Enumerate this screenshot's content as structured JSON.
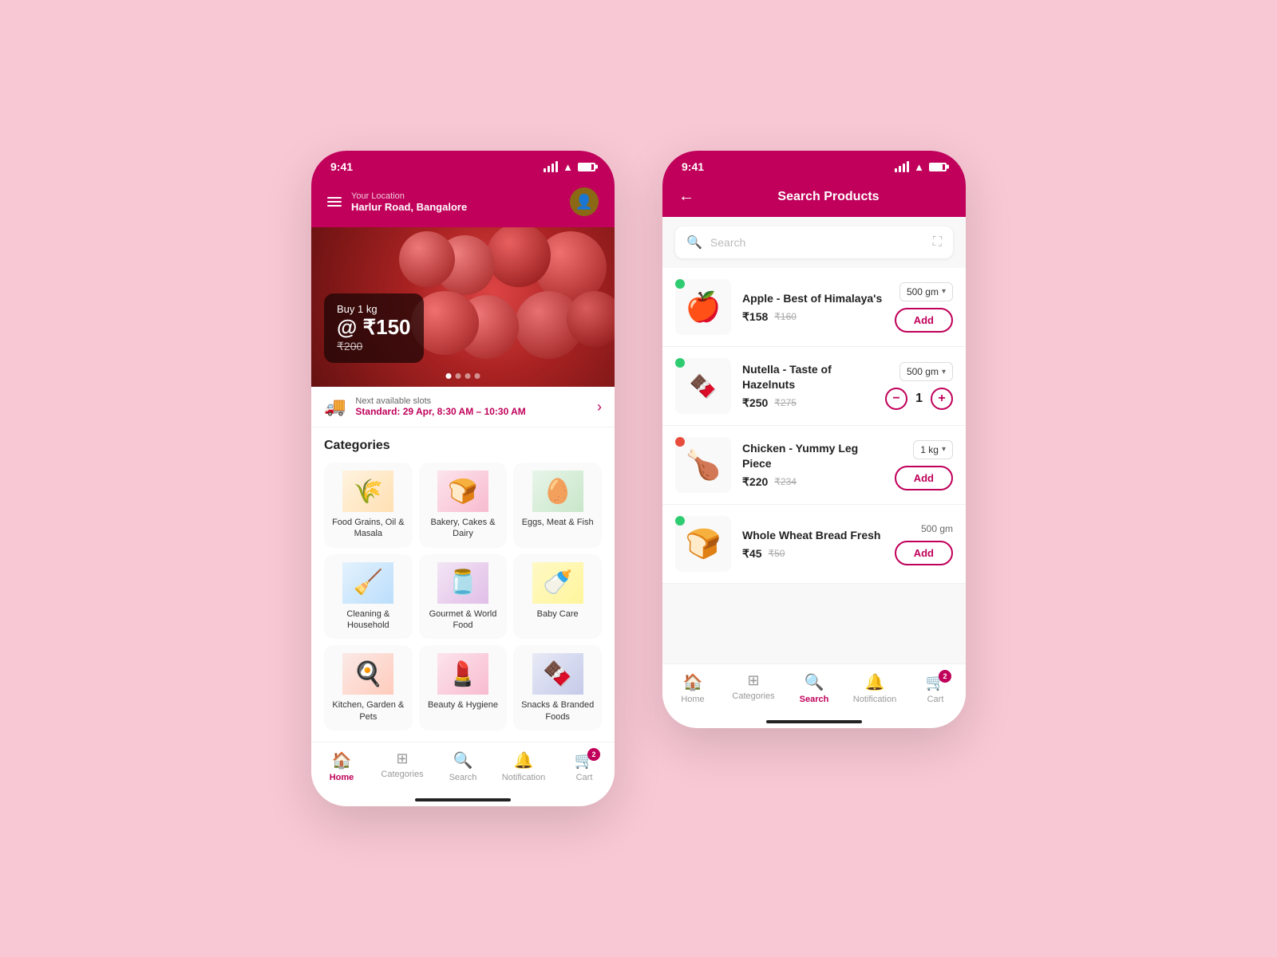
{
  "app": {
    "status_time": "9:41",
    "brand_color": "#c0005a"
  },
  "home_screen": {
    "location_label": "Your Location",
    "location_value": "Harlur Road, Bangalore",
    "banner": {
      "buy_text": "Buy 1 kg",
      "price_main": "@ ₹150",
      "price_old": "₹200"
    },
    "delivery": {
      "label": "Next available slots",
      "value": "Standard: 29 Apr, 8:30 AM – 10:30 AM"
    },
    "categories_title": "Categories",
    "categories": [
      {
        "label": "Food Grains, Oil & Masala",
        "emoji": "🌾"
      },
      {
        "label": "Bakery, Cakes & Dairy",
        "emoji": "🍞"
      },
      {
        "label": "Eggs, Meat & Fish",
        "emoji": "🥚"
      },
      {
        "label": "Cleaning & Household",
        "emoji": "🧹"
      },
      {
        "label": "Gourmet & World Food",
        "emoji": "🫙"
      },
      {
        "label": "Baby Care",
        "emoji": "🍼"
      },
      {
        "label": "Kitchen, Garden & Pets",
        "emoji": "🍳"
      },
      {
        "label": "Beauty & Hygiene",
        "emoji": "💄"
      },
      {
        "label": "Snacks & Branded Foods",
        "emoji": "🍫"
      }
    ],
    "nav": [
      {
        "label": "Home",
        "icon": "🏠",
        "active": true
      },
      {
        "label": "Categories",
        "icon": "⊞",
        "active": false
      },
      {
        "label": "Search",
        "icon": "🔍",
        "active": false
      },
      {
        "label": "Notification",
        "icon": "🔔",
        "active": false
      },
      {
        "label": "Cart",
        "icon": "🛒",
        "active": false,
        "badge": "2"
      }
    ]
  },
  "search_screen": {
    "title": "Search Products",
    "search_placeholder": "Search",
    "products": [
      {
        "name": "Apple - Best of Himalaya's",
        "price": "₹158",
        "original_price": "₹160",
        "weight": "500 gm",
        "has_dropdown": true,
        "action": "add",
        "status": "green",
        "emoji": "🍎"
      },
      {
        "name": "Nutella - Taste of Hazelnuts",
        "price": "₹250",
        "original_price": "₹275",
        "weight": "500 gm",
        "has_dropdown": true,
        "action": "qty",
        "qty": "1",
        "status": "green",
        "emoji": "🍫"
      },
      {
        "name": "Chicken - Yummy Leg Piece",
        "price": "₹220",
        "original_price": "₹234",
        "weight": "1 kg",
        "has_dropdown": true,
        "action": "add",
        "status": "red",
        "emoji": "🍗"
      },
      {
        "name": "Whole Wheat Bread Fresh",
        "price": "₹45",
        "original_price": "₹50",
        "weight": "500 gm",
        "has_dropdown": false,
        "action": "add",
        "status": "green",
        "emoji": "🍞"
      }
    ],
    "nav": [
      {
        "label": "Home",
        "icon": "🏠",
        "active": false
      },
      {
        "label": "Categories",
        "icon": "⊞",
        "active": false
      },
      {
        "label": "Search",
        "icon": "🔍",
        "active": true
      },
      {
        "label": "Notification",
        "icon": "🔔",
        "active": false
      },
      {
        "label": "Cart",
        "icon": "🛒",
        "active": false,
        "badge": "2"
      }
    ]
  }
}
